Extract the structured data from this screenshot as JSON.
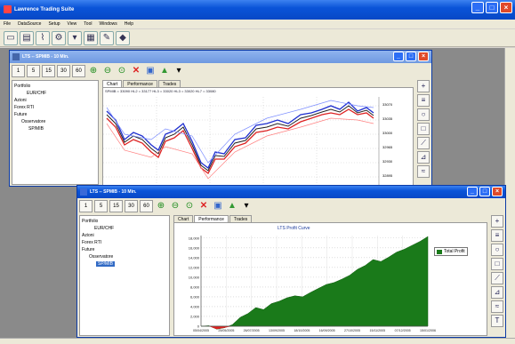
{
  "app": {
    "title": "Lawrence Trading Suite"
  },
  "menu": [
    "File",
    "DataSource",
    "Setup",
    "View",
    "Tool",
    "Windows",
    "Help"
  ],
  "toolbar_icons": [
    "open-icon",
    "save-icon",
    "chart-icon",
    "settings-icon",
    "filter-icon",
    "layout-icon",
    "wizard-icon",
    "logo-icon"
  ],
  "window_back": {
    "title": "LTS -- SPMIB - 10 Min.",
    "timeframes": [
      "1",
      "5",
      "15",
      "30",
      "60"
    ],
    "tree": [
      "Portfolio",
      "EUR/CHF",
      "Azioni",
      "Forex RTI",
      "Future",
      "Osservatore",
      "SP/MIB"
    ],
    "tabs": [
      "Chart",
      "Performance",
      "Trades"
    ],
    "active_tab": "Chart",
    "header": "SPMIB = 33090   HL2 = 33177   HL3 = 33020   HL3 = 33020   HL7 = 33080",
    "price_labels": [
      "33070",
      "33035",
      "33000",
      "32965",
      "32930",
      "32895",
      "32860"
    ]
  },
  "window_front": {
    "title": "LTS -- SPMIB - 10 Min.",
    "timeframes": [
      "1",
      "5",
      "15",
      "30",
      "60"
    ],
    "tree": [
      "Portfolio",
      "EUR/CHF",
      "Azioni",
      "Forex RTI",
      "Future",
      "Osservatore",
      "SP/MIB"
    ],
    "tree_selected": "SP/MIB",
    "tabs": [
      "Chart",
      "Performance",
      "Trades"
    ],
    "active_tab": "Performance",
    "legend": "Total Profit"
  },
  "chart_data": {
    "type": "area",
    "title": "LTS Profit Curve",
    "categories": [
      "05/04/2005",
      "25/05/2005",
      "26/07/2005",
      "13/09/2005",
      "18/10/2005",
      "16/09/2005",
      "27/10/2005",
      "15/11/2005",
      "07/12/2005",
      "15/01/2006"
    ],
    "y_ticks": [
      0,
      2000,
      4000,
      6000,
      8000,
      10000,
      12000,
      14000,
      16000,
      18000
    ],
    "ylim": [
      0,
      18500
    ],
    "series": [
      {
        "name": "Total Profit",
        "color": "#1a7a1a",
        "values": [
          0,
          100,
          -600,
          -300,
          300,
          1800,
          2600,
          3800,
          3400,
          4600,
          5100,
          5800,
          6200,
          6000,
          6900,
          7700,
          8500,
          8900,
          9600,
          10400,
          11600,
          12400,
          13600,
          13200,
          14100,
          15100,
          15700,
          16500,
          17300,
          18300
        ]
      }
    ]
  }
}
